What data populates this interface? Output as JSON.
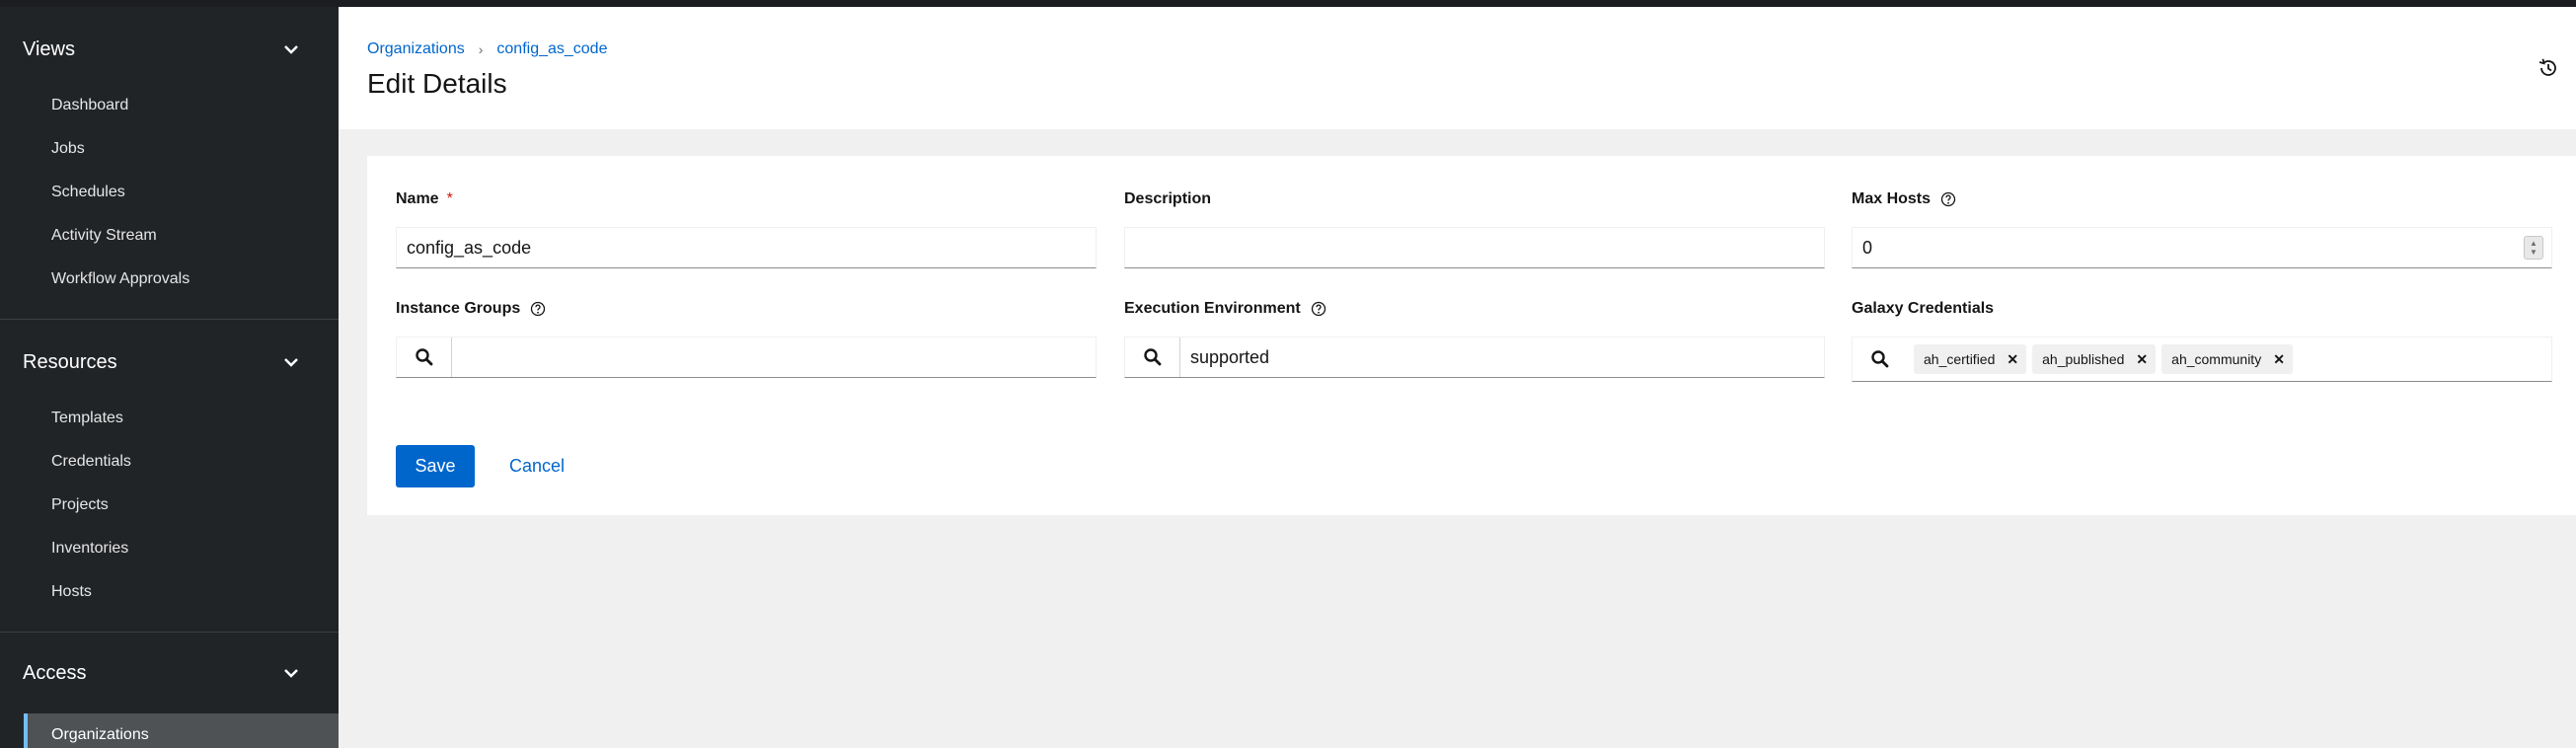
{
  "sidebar": {
    "groups": [
      {
        "title": "Views",
        "items": [
          "Dashboard",
          "Jobs",
          "Schedules",
          "Activity Stream",
          "Workflow Approvals"
        ]
      },
      {
        "title": "Resources",
        "items": [
          "Templates",
          "Credentials",
          "Projects",
          "Inventories",
          "Hosts"
        ]
      },
      {
        "title": "Access",
        "items": [
          "Organizations"
        ]
      }
    ],
    "active_item": "Organizations"
  },
  "header": {
    "breadcrumb": [
      "Organizations",
      "config_as_code"
    ],
    "breadcrumb_separator": "›",
    "title": "Edit Details"
  },
  "form": {
    "name": {
      "label": "Name",
      "required_mark": "*",
      "value": "config_as_code"
    },
    "description": {
      "label": "Description",
      "value": ""
    },
    "max_hosts": {
      "label": "Max Hosts",
      "value": "0"
    },
    "instance_groups": {
      "label": "Instance Groups",
      "value": ""
    },
    "execution_environment": {
      "label": "Execution Environment",
      "value": "supported"
    },
    "galaxy_credentials": {
      "label": "Galaxy Credentials",
      "chips": [
        "ah_certified",
        "ah_published",
        "ah_community"
      ]
    },
    "save_label": "Save",
    "cancel_label": "Cancel"
  },
  "colors": {
    "accent": "#0066cc",
    "sidebar_bg": "#212427",
    "active_indicator": "#73bcf7",
    "required": "#c9190b"
  }
}
